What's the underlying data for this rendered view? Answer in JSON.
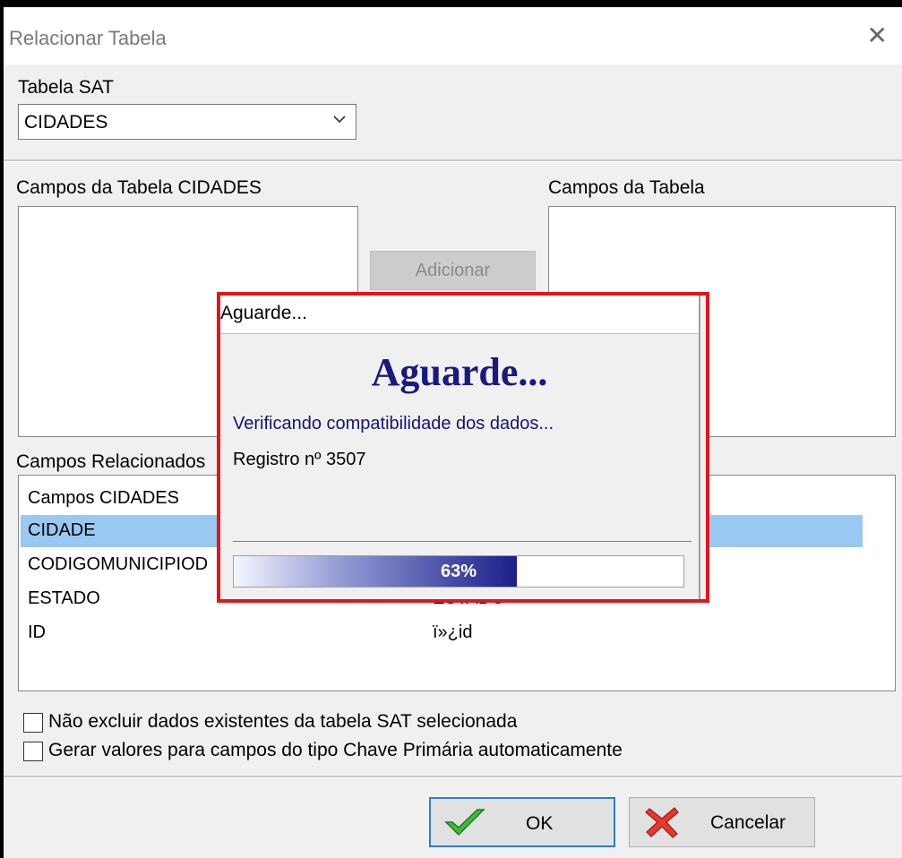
{
  "window": {
    "title": "Relacionar Tabela",
    "close_glyph": "✕"
  },
  "tabela_sat": {
    "label": "Tabela SAT",
    "value": "CIDADES"
  },
  "left_list": {
    "label": "Campos da Tabela CIDADES"
  },
  "right_list": {
    "label": "Campos da Tabela"
  },
  "add_button": {
    "label": "Adicionar"
  },
  "related": {
    "label": "Campos Relacionados",
    "header_left": "Campos CIDADES",
    "rows": [
      {
        "left": "CIDADE",
        "right": "",
        "selected": true
      },
      {
        "left": "CODIGOMUNICIPIOD",
        "right": ""
      },
      {
        "left": "ESTADO",
        "right": "ESTADO"
      },
      {
        "left": "ID",
        "right": "ï»¿id"
      }
    ]
  },
  "options": {
    "keep_data": "Não excluir dados existentes da tabela SAT selecionada",
    "gen_keys": "Gerar valores para campos do tipo Chave Primária automaticamente"
  },
  "buttons": {
    "ok": "OK",
    "cancel": "Cancelar"
  },
  "progress_dialog": {
    "title": "Aguarde...",
    "heading": "Aguarde...",
    "message": "Verificando compatibilidade dos dados...",
    "record": "Registro nº 3507",
    "progress_percent": 63,
    "progress_text": "63%",
    "highlight_color": "#e3141c"
  },
  "icons": {
    "ok": "checkmark-icon",
    "cancel": "red-x-icon",
    "dropdown": "chevron-down-icon"
  }
}
